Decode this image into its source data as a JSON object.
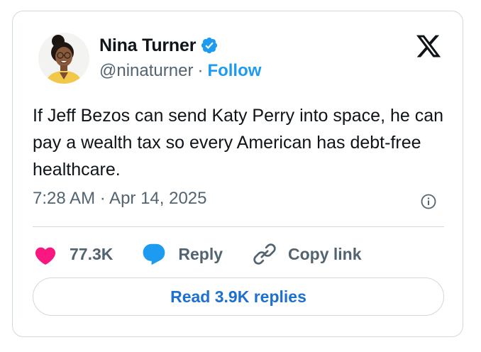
{
  "author": {
    "name": "Nina Turner",
    "handle": "@ninaturner",
    "separator": "·",
    "follow_label": "Follow",
    "verified": true,
    "verified_color": "#1d9bf0"
  },
  "tweet": {
    "text": "If Jeff Bezos can send Katy Perry into space, he can pay a wealth tax so every American has debt-free healthcare.",
    "timestamp": "7:28 AM · Apr 14, 2025"
  },
  "actions": {
    "likes": "77.3K",
    "reply_label": "Reply",
    "copy_link_label": "Copy link",
    "like_color": "#f91880",
    "reply_color": "#1d9bf0"
  },
  "replies_button": {
    "label": "Read 3.9K replies"
  },
  "icons": {
    "brand": "x-logo-icon",
    "info": "info-icon",
    "like": "heart-icon",
    "reply": "speech-bubble-icon",
    "copy": "link-icon",
    "verified": "verified-badge-icon"
  }
}
